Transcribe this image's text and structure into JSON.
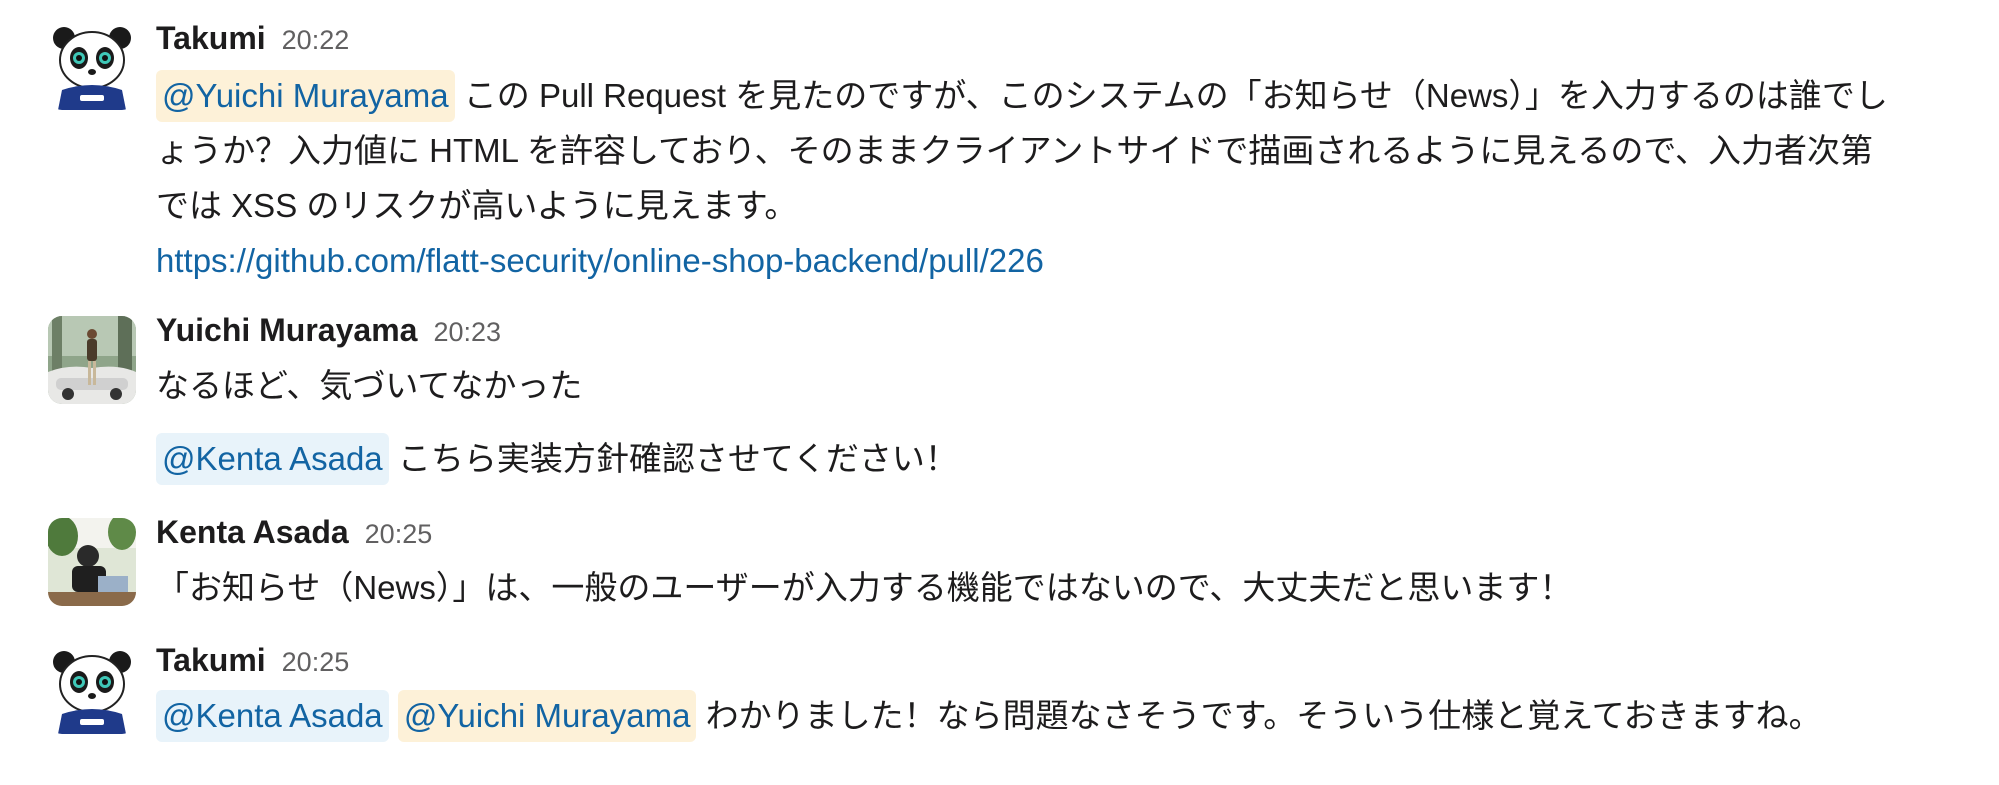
{
  "colors": {
    "link": "#1264a3",
    "mention_you_bg": "#fdf1d8",
    "mention_other_bg": "#e8f3fa",
    "timestamp": "#616061"
  },
  "messages": [
    {
      "author": "Takumi",
      "time": "20:22",
      "avatar_icon": "panda-avatar-icon",
      "mention": "@Yuichi Murayama",
      "line1": "この Pull Request を見たのですが、このシステムの「お知らせ（News）」を入力するのは誰でし",
      "line2": "ょうか？入力値に HTML を許容しており、そのままクライアントサイドで描画されるように見えるので、入力者次第",
      "line3": "では XSS のリスクが高いように見えます。",
      "link": "https://github.com/flatt-security/online-shop-backend/pull/226"
    },
    {
      "author": "Yuichi Murayama",
      "time": "20:23",
      "avatar_icon": "photo-avatar-icon",
      "text": "なるほど、気づいてなかった",
      "mention": "@Kenta Asada",
      "text2": "こちら実装方針確認させてください！"
    },
    {
      "author": "Kenta Asada",
      "time": "20:25",
      "avatar_icon": "photo-avatar-icon",
      "text": "「お知らせ（News）」は、一般のユーザーが入力する機能ではないので、大丈夫だと思います！"
    },
    {
      "author": "Takumi",
      "time": "20:25",
      "avatar_icon": "panda-avatar-icon",
      "mention1": "@Kenta Asada",
      "mention2": "@Yuichi Murayama",
      "text": "わかりました！なら問題なさそうです。そういう仕様と覚えておきますね。"
    }
  ]
}
